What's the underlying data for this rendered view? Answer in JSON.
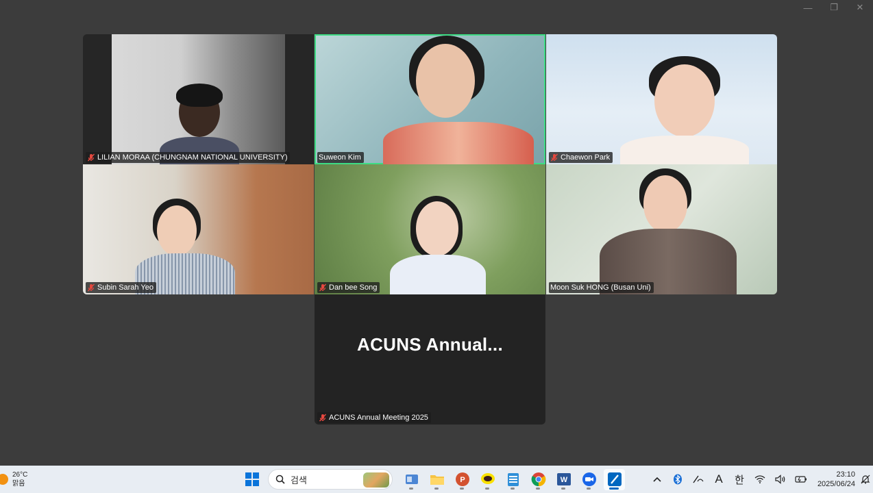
{
  "window": {
    "controls": {
      "minimize": "—",
      "restore": "❐",
      "close": "✕"
    }
  },
  "participants": [
    {
      "name": "LILIAN MORAA (CHUNGNAM NATIONAL UNIVERSITY)",
      "muted": true,
      "active": false
    },
    {
      "name": "Suweon Kim",
      "muted": false,
      "active": true
    },
    {
      "name": "Chaewon Park",
      "muted": true,
      "active": false
    },
    {
      "name": "Subin Sarah Yeo",
      "muted": true,
      "active": false
    },
    {
      "name": "Dan bee Song",
      "muted": true,
      "active": false
    },
    {
      "name": "Moon Suk HONG (Busan Uni)",
      "muted": false,
      "active": false
    }
  ],
  "no_video_tile": {
    "display_text": "ACUNS  Annual...",
    "name": "ACUNS Annual Meeting 2025",
    "muted": true
  },
  "taskbar": {
    "weather": {
      "temp": "26°C",
      "condition": "맑음"
    },
    "search": {
      "placeholder": "검색"
    },
    "apps": [
      "windows-start",
      "file-explorer",
      "powerpoint",
      "kakaotalk",
      "notepad",
      "chrome",
      "word",
      "zoom",
      "pen-app"
    ],
    "tray": {
      "ime_mode": "A",
      "ime_lang": "한"
    },
    "clock": {
      "time": "23:10",
      "date": "2025/06/24"
    }
  },
  "colors": {
    "active_speaker": "#3ddc84",
    "muted_mic": "#e5483f",
    "background": "#3c3c3c"
  }
}
